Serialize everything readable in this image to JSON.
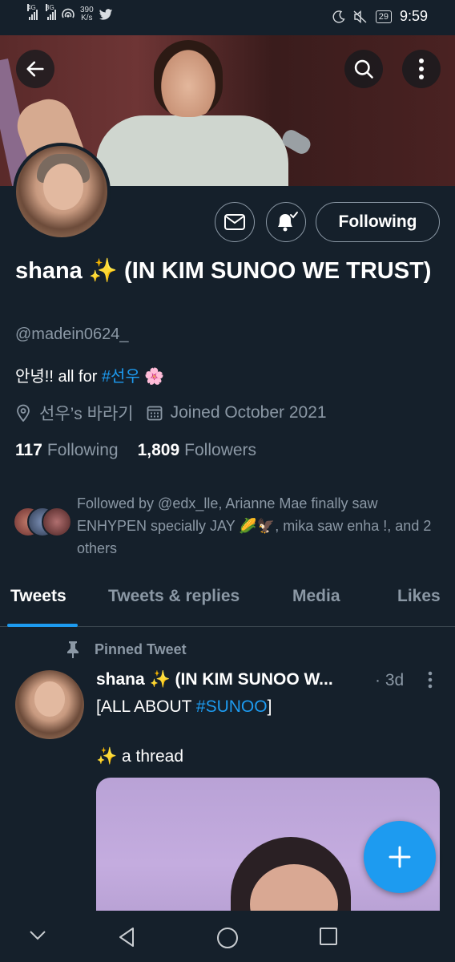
{
  "status_bar": {
    "net1": "4G",
    "net2": "3G",
    "speed_value": "390",
    "speed_unit": "K/s",
    "battery": "29",
    "time": "9:59",
    "icons": [
      "signal-icon",
      "wifi-hotspot-icon",
      "twitter-icon",
      "moon-icon",
      "mute-icon",
      "battery-icon"
    ]
  },
  "header": {
    "back_icon": "arrow-left-icon",
    "search_icon": "search-icon",
    "more_icon": "more-vertical-icon"
  },
  "profile": {
    "name": "shana ✨ (IN KIM SUNOO WE TRUST)",
    "handle": "@madein0624_",
    "bio_prefix": "안녕!! all for ",
    "bio_tag": "#선우",
    "bio_suffix": " 🌸",
    "location": "선우’s 바라기",
    "joined": "Joined October 2021",
    "following_count": "117",
    "following_label": "Following",
    "followers_count": "1,809",
    "followers_label": "Followers",
    "followed_by": "Followed by @edx_lle, Arianne Mae finally saw ENHYPEN specially JAY 🌽🦅, mika saw enha !, and 2 others",
    "follow_button": "Following",
    "accent": "#1d9bf0"
  },
  "tabs": [
    {
      "label": "Tweets",
      "active": true
    },
    {
      "label": "Tweets & replies",
      "active": false
    },
    {
      "label": "Media",
      "active": false
    },
    {
      "label": "Likes",
      "active": false
    }
  ],
  "tweet": {
    "pinned_label": "Pinned Tweet",
    "author": "shana ✨ (IN KIM SUNOO W...",
    "time": "· 3d",
    "line1_prefix": "[ALL ABOUT ",
    "line1_tag": "#SUNOO",
    "line1_suffix": "]",
    "line2": "✨ a thread"
  },
  "nav": {
    "icons": [
      "chevron-down-icon",
      "back-triangle-icon",
      "home-circle-icon",
      "recents-square-icon"
    ]
  }
}
